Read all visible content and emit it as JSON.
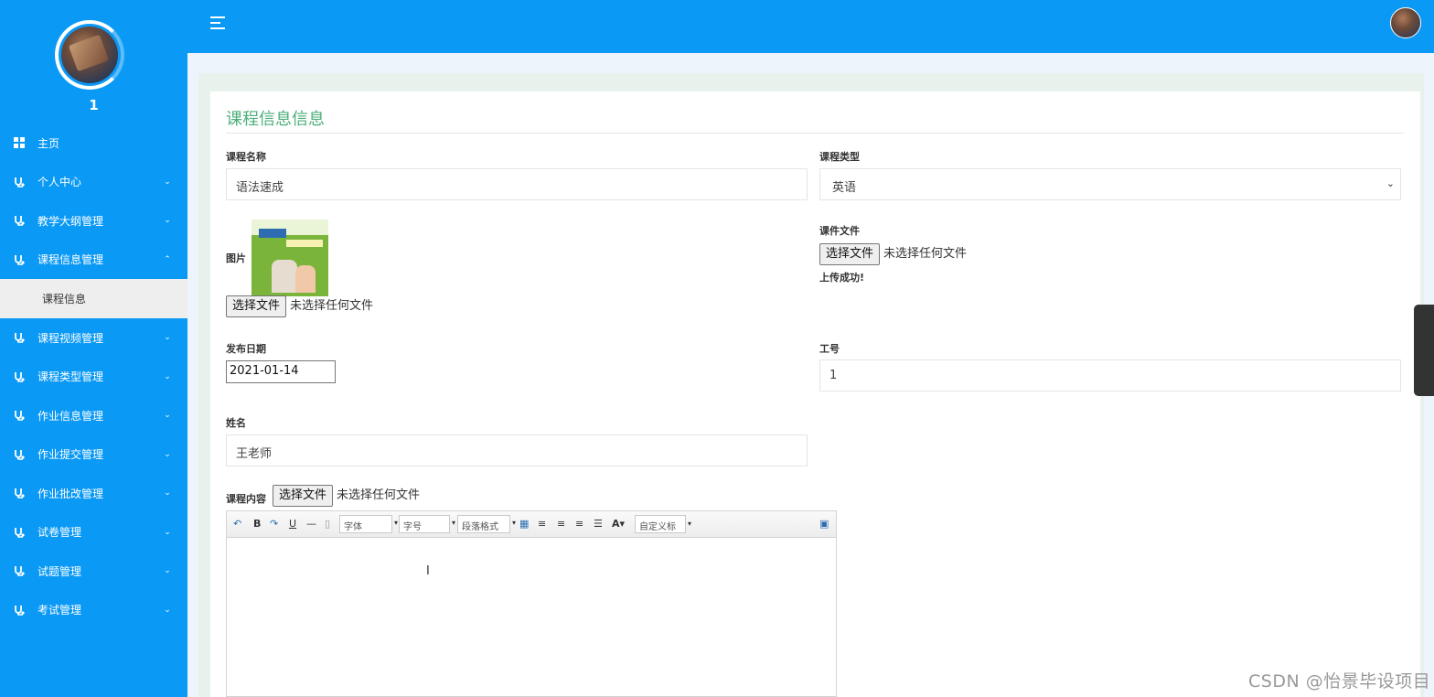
{
  "sidebar": {
    "profile_name": "1",
    "items": [
      {
        "label": "主页",
        "icon": "dashboard-icon",
        "chevron": ""
      },
      {
        "label": "个人中心",
        "icon": "stethoscope-icon",
        "chevron": "⌄"
      },
      {
        "label": "教学大纲管理",
        "icon": "stethoscope-icon",
        "chevron": "⌄"
      },
      {
        "label": "课程信息管理",
        "icon": "stethoscope-icon",
        "chevron": "⌃"
      },
      {
        "label": "课程视频管理",
        "icon": "stethoscope-icon",
        "chevron": "⌄"
      },
      {
        "label": "课程类型管理",
        "icon": "stethoscope-icon",
        "chevron": "⌄"
      },
      {
        "label": "作业信息管理",
        "icon": "stethoscope-icon",
        "chevron": "⌄"
      },
      {
        "label": "作业提交管理",
        "icon": "stethoscope-icon",
        "chevron": "⌄"
      },
      {
        "label": "作业批改管理",
        "icon": "stethoscope-icon",
        "chevron": "⌄"
      },
      {
        "label": "试卷管理",
        "icon": "stethoscope-icon",
        "chevron": "⌄"
      },
      {
        "label": "试题管理",
        "icon": "stethoscope-icon",
        "chevron": "⌄"
      },
      {
        "label": "考试管理",
        "icon": "stethoscope-icon",
        "chevron": "⌄"
      }
    ],
    "submenu_label": "课程信息"
  },
  "form": {
    "title": "课程信息信息",
    "course_name_label": "课程名称",
    "course_name_value": "语法速成",
    "course_type_label": "课程类型",
    "course_type_value": "英语",
    "image_label": "图片",
    "file_button": "选择文件",
    "no_file": "未选择任何文件",
    "courseware_label": "课件文件",
    "upload_ok": "上传成功!",
    "publish_date_label": "发布日期",
    "publish_date_value": "2021-01-14",
    "staff_id_label": "工号",
    "staff_id_value": "1",
    "name_label": "姓名",
    "name_value": "王老师",
    "content_label": "课程内容"
  },
  "editor": {
    "font_family": "字体",
    "font_size": "字号",
    "paragraph": "段落格式",
    "custom_title": "自定义标题"
  },
  "watermark": "CSDN @怡景毕设项目",
  "colors": {
    "primary": "#0a99f5",
    "title_green": "#4caf7a"
  }
}
